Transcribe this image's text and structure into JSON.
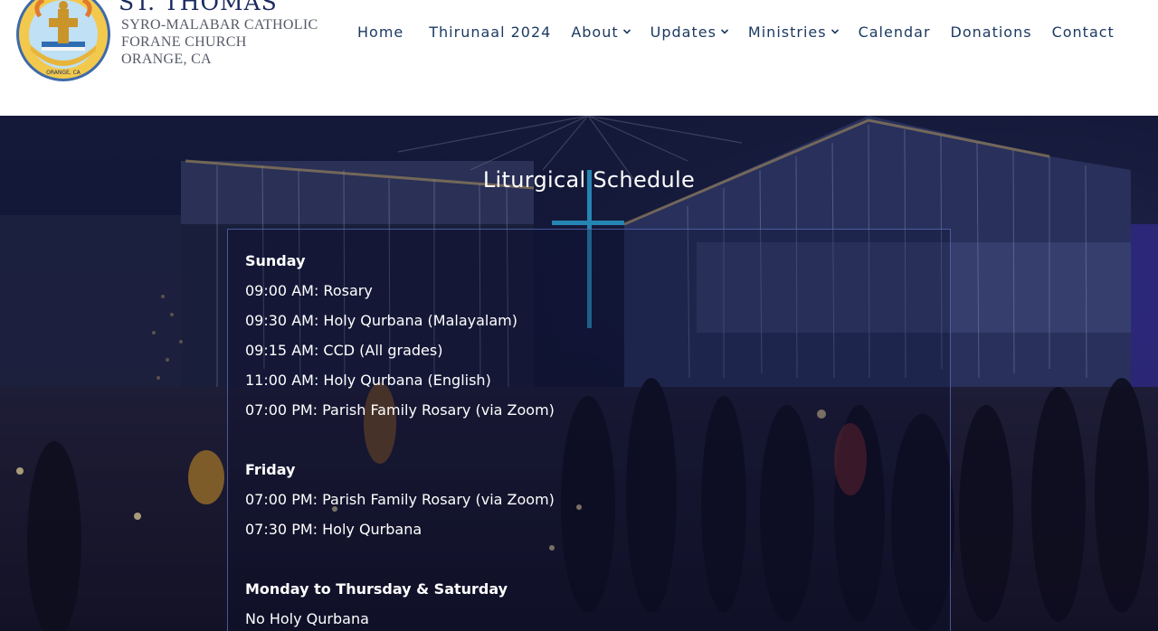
{
  "brand": {
    "title": "ST. THOMAS",
    "line1": "SYRO-MALABAR CATHOLIC",
    "line2": "FORANE CHURCH",
    "line3": "ORANGE, CA",
    "logo_text": "ST. THOMAS SYRO MALABAR FORANE CHURCH ORANGE, CA"
  },
  "nav": {
    "items": [
      {
        "label": "Home",
        "has_dropdown": false
      },
      {
        "label": "Thirunaal 2024",
        "has_dropdown": false
      },
      {
        "label": "About",
        "has_dropdown": true
      },
      {
        "label": "Updates",
        "has_dropdown": true
      },
      {
        "label": "Ministries",
        "has_dropdown": true
      },
      {
        "label": "Calendar",
        "has_dropdown": false
      },
      {
        "label": "Donations",
        "has_dropdown": false
      },
      {
        "label": "Contact",
        "has_dropdown": false
      }
    ]
  },
  "hero": {
    "title": "Liturgical Schedule",
    "sections": [
      {
        "day": "Sunday",
        "items": [
          "09:00 AM: Rosary",
          "09:30 AM: Holy Qurbana (Malayalam)",
          "09:15 AM: CCD (All grades)",
          "11:00 AM: Holy Qurbana (English)",
          "07:00 PM: Parish Family Rosary (via Zoom)"
        ]
      },
      {
        "day": "Friday",
        "items": [
          "07:00 PM: Parish Family Rosary (via Zoom)",
          "07:30 PM: Holy Qurbana"
        ]
      },
      {
        "day": "Monday to Thursday & Saturday",
        "items": [
          "No Holy Qurbana"
        ]
      }
    ]
  },
  "colors": {
    "nav_text": "#1c3a63",
    "hero_bg": "#141733",
    "logo_gold": "#e8b53a",
    "logo_blue": "#7fb6e0"
  },
  "icons": {
    "dropdown": "chevron-down-icon",
    "logo": "church-seal-logo"
  }
}
